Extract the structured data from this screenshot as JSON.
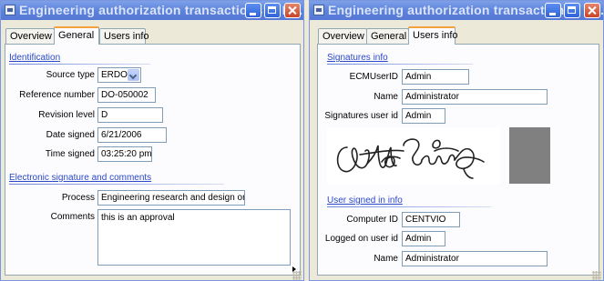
{
  "left_window": {
    "title": "Engineering authorization transactions - , R...",
    "tabs": [
      "Overview",
      "General",
      "Users info"
    ],
    "active_tab": "General",
    "identification": {
      "section_label": "Identification",
      "source_type": {
        "label": "Source type",
        "value": "ERDO"
      },
      "reference_number": {
        "label": "Reference number",
        "value": "DO-050002"
      },
      "revision_level": {
        "label": "Revision level",
        "value": "D"
      },
      "date_signed": {
        "label": "Date signed",
        "value": "6/21/2006"
      },
      "time_signed": {
        "label": "Time signed",
        "value": "03:25:20 pm"
      }
    },
    "esig": {
      "section_label": "Electronic signature and comments",
      "process": {
        "label": "Process",
        "value": "Engineering research and design order"
      },
      "comments": {
        "label": "Comments",
        "value": "this is an approval"
      }
    }
  },
  "right_window": {
    "title": "Engineering authorization transactions - , R...",
    "tabs": [
      "Overview",
      "General",
      "Users info"
    ],
    "active_tab": "Users info",
    "signatures": {
      "section_label": "Signatures info",
      "ecm_user_id": {
        "label": "ECMUserID",
        "value": "Admin"
      },
      "name": {
        "label": "Name",
        "value": "Administrator"
      },
      "sig_user_id": {
        "label": "Signatures user id",
        "value": "Admin"
      }
    },
    "user_signed_in": {
      "section_label": "User signed in info",
      "computer_id": {
        "label": "Computer ID",
        "value": "CENTVIO"
      },
      "logged_on_user_id": {
        "label": "Logged on user id",
        "value": "Admin"
      },
      "name": {
        "label": "Name",
        "value": "Administrator"
      }
    }
  },
  "icons": [
    "window-app-icon",
    "minimize-icon",
    "maximize-icon",
    "close-icon",
    "chevron-down-icon",
    "signature-image",
    "scroll-right-icon",
    "resize-grip-icon"
  ],
  "colors": {
    "titlebar": "#5d84dc",
    "section_link": "#2b48c8",
    "active_tab_accent": "#f6a13b",
    "window_bg": "#ece9d8"
  }
}
